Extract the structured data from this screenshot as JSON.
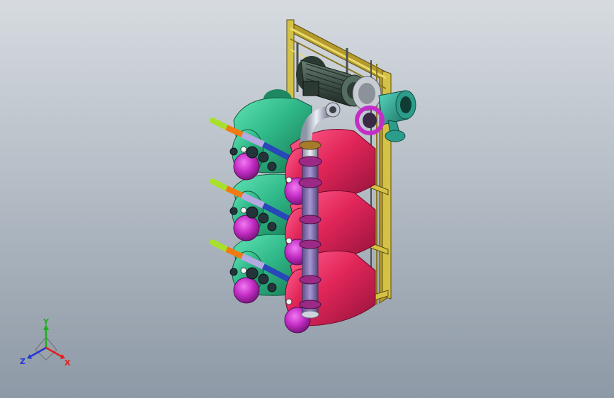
{
  "viewport": {
    "background_top": "#d6dbe0",
    "background_bottom": "#8d99a6"
  },
  "model": {
    "name": "",
    "colors": {
      "green_tank": "#2fb888",
      "red_tank": "#e2265a",
      "magenta_cap": "#c52ec6",
      "frame_yellow": "#d4c246",
      "frame_dark": "#4d5052",
      "motor": "#3f5148",
      "pump_teal": "#2b9d8a",
      "pipe_purple": "#8e7cb4",
      "pipe_silver": "#c6cbd8",
      "lime": "#a8e02a",
      "orange": "#f07a12",
      "lavender": "#b5a9e2",
      "blue": "#2748b8"
    },
    "tank_levels": 3
  },
  "triad": {
    "labels": {
      "y": "Y",
      "z": "Z",
      "x": "X"
    },
    "colors": {
      "x": "#e02020",
      "y": "#1fae1f",
      "z": "#2536d6"
    }
  }
}
